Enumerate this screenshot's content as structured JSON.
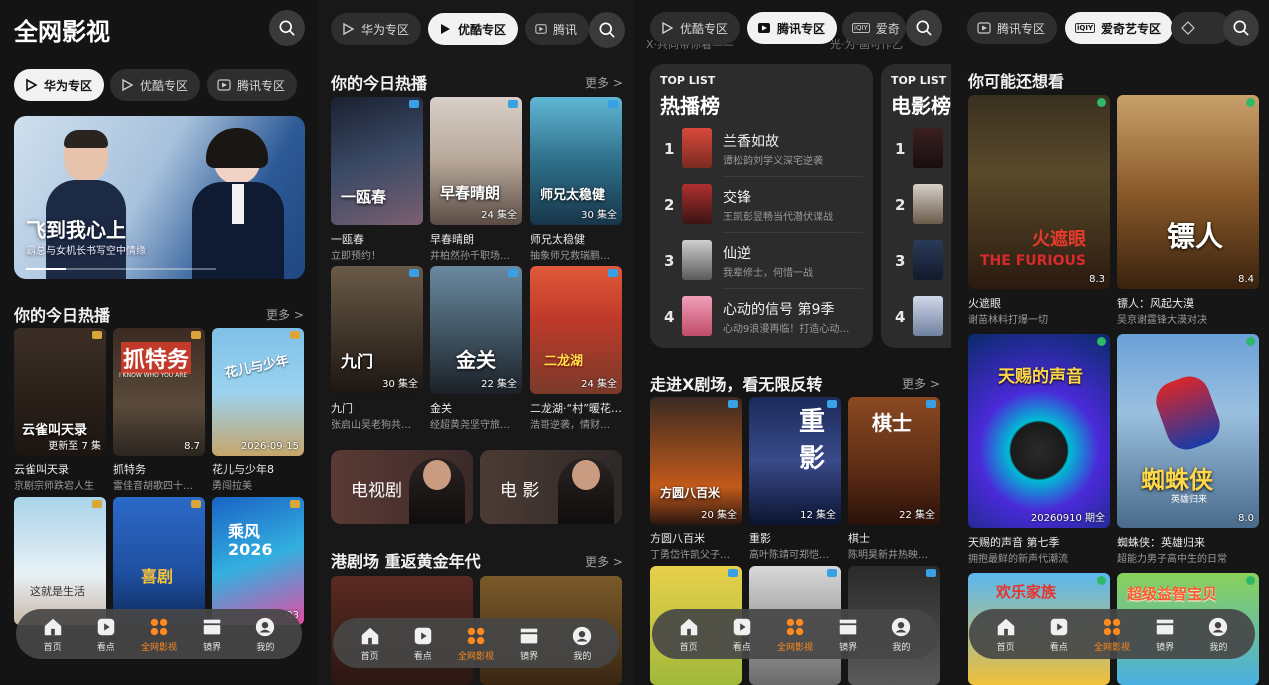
{
  "app": {
    "title": "全网影视"
  },
  "tabs": {
    "huawei": "华为专区",
    "youku": "优酷专区",
    "tencent": "腾讯专区",
    "iqiyi": "爱奇艺专区",
    "tencent_partial": "腾讯",
    "iqiyi_partial": "爱奇",
    "iqiyi_icon_text": "iQIY"
  },
  "hero": {
    "title": "飞到我心上",
    "subtitle": "霸总与女机长书写空中情缘"
  },
  "panel1": {
    "section_title": "你的今日热播",
    "more": "更多 >",
    "items": [
      {
        "name": "云雀叫天录",
        "desc": "京剧宗师跌宕人生",
        "badge": "更新至 7 集",
        "poster_text": "云雀叫天录"
      },
      {
        "name": "抓特务",
        "desc": "雷佳音胡歌四十…",
        "badge": "8.7",
        "poster_text": "抓特务",
        "poster_sub": "I KNOW WHO YOU ARE"
      },
      {
        "name": "花儿与少年8",
        "desc": "勇闯拉美",
        "badge": "2026-09-15",
        "poster_text": "花儿与少年"
      },
      {
        "name": "",
        "desc": "",
        "badge": "",
        "poster_text": "这就是生活"
      },
      {
        "name": "",
        "desc": "",
        "badge": "",
        "poster_text": "喜剧"
      },
      {
        "name": "",
        "desc": "",
        "badge": "03",
        "poster_text": "乘风 2026"
      }
    ]
  },
  "panel2": {
    "section_title": "你的今日热播",
    "more": "更多 >",
    "items": [
      {
        "name": "一瓯春",
        "desc": "立即预约！",
        "badge": "",
        "poster_text": "一瓯春"
      },
      {
        "name": "早春晴朗",
        "desc": "井柏然孙千职场…",
        "badge": "24 集全",
        "poster_text": "早春晴朗"
      },
      {
        "name": "师兄太稳健",
        "desc": "抽象师兄救瑞鹏…",
        "badge": "30 集全",
        "poster_text": "师兄太稳健"
      },
      {
        "name": "九门",
        "desc": "张启山吴老狗共…",
        "badge": "30 集全",
        "poster_text": "九门"
      },
      {
        "name": "金关",
        "desc": "经超黄尧坚守旅…",
        "badge": "22 集全",
        "poster_text": "金关"
      },
      {
        "name": "二龙湖·“村”暖花…",
        "desc": "浩哥逆袭，情财…",
        "badge": "24 集全",
        "poster_text": "二龙湖"
      }
    ],
    "cat_tv": "电视剧",
    "cat_movie": "电 影",
    "section2_title": "港剧场 重返黄金年代",
    "more2": "更多 >"
  },
  "panel3": {
    "hot": {
      "label": "TOP LIST",
      "title": "热播榜",
      "items": [
        {
          "rank": "1",
          "name": "兰香如故",
          "desc": "谭松韵刘学义深宅逆袭"
        },
        {
          "rank": "2",
          "name": "交锋",
          "desc": "王凯彭昱畅当代潜伏谍战"
        },
        {
          "rank": "3",
          "name": "仙逆",
          "desc": "我辈修士，何惜一战"
        },
        {
          "rank": "4",
          "name": "心动的信号 第9季",
          "desc": "心动9浪漫再临！打造心动…"
        }
      ]
    },
    "movie": {
      "label": "TOP LIST",
      "title": "电影榜",
      "ranks": [
        "1",
        "2",
        "3",
        "4"
      ]
    },
    "section_title": "走进X剧场，看无限反转",
    "more": "更多 >",
    "items": [
      {
        "name": "方圆八百米",
        "desc": "丁勇岱许凯父子…",
        "badge": "20 集全",
        "poster_text": "方圆八百米"
      },
      {
        "name": "重影",
        "desc": "高叶陈靖可郑恺…",
        "badge": "12 集全",
        "poster_text": "重影"
      },
      {
        "name": "棋士",
        "desc": "陈明昊新井热映…",
        "badge": "22 集全",
        "poster_text": "棋士"
      }
    ],
    "top_partial_left": "X·共同带你看——",
    "top_partial_right": "光·为·画可作乙"
  },
  "panel4": {
    "section_title": "你可能还想看",
    "items": [
      {
        "name": "火遮眼",
        "desc": "谢苗林料打爆一切",
        "badge": "8.3",
        "poster_text": "火遮眼",
        "poster_sub": "THE FURIOUS"
      },
      {
        "name": "镖人：风起大漠",
        "desc": "吴京谢霆锋大漠对决",
        "badge": "8.4",
        "poster_text": "镖人"
      },
      {
        "name": "天赐的声音 第七季",
        "desc": "拥抱最鲜的新声代潮流",
        "badge": "20260910 期全",
        "poster_text": "天赐的声音"
      },
      {
        "name": "蜘蛛侠：英雄归来",
        "desc": "超能力男子高中生的日常",
        "badge": "8.0",
        "poster_text": "蜘蛛侠",
        "poster_sub": "英雄归来"
      },
      {
        "name": "",
        "desc": "",
        "badge": "",
        "poster_text": "欢乐家族"
      },
      {
        "name": "",
        "desc": "",
        "badge": "",
        "poster_text": "超级益智宝贝"
      }
    ]
  },
  "nav": {
    "home": "首页",
    "watch": "看点",
    "all_video": "全网影视",
    "world": "镜界",
    "mine": "我的"
  },
  "colors": {
    "accent": "#ff8a1f",
    "background": "#141414",
    "card": "#2c2c2c"
  }
}
